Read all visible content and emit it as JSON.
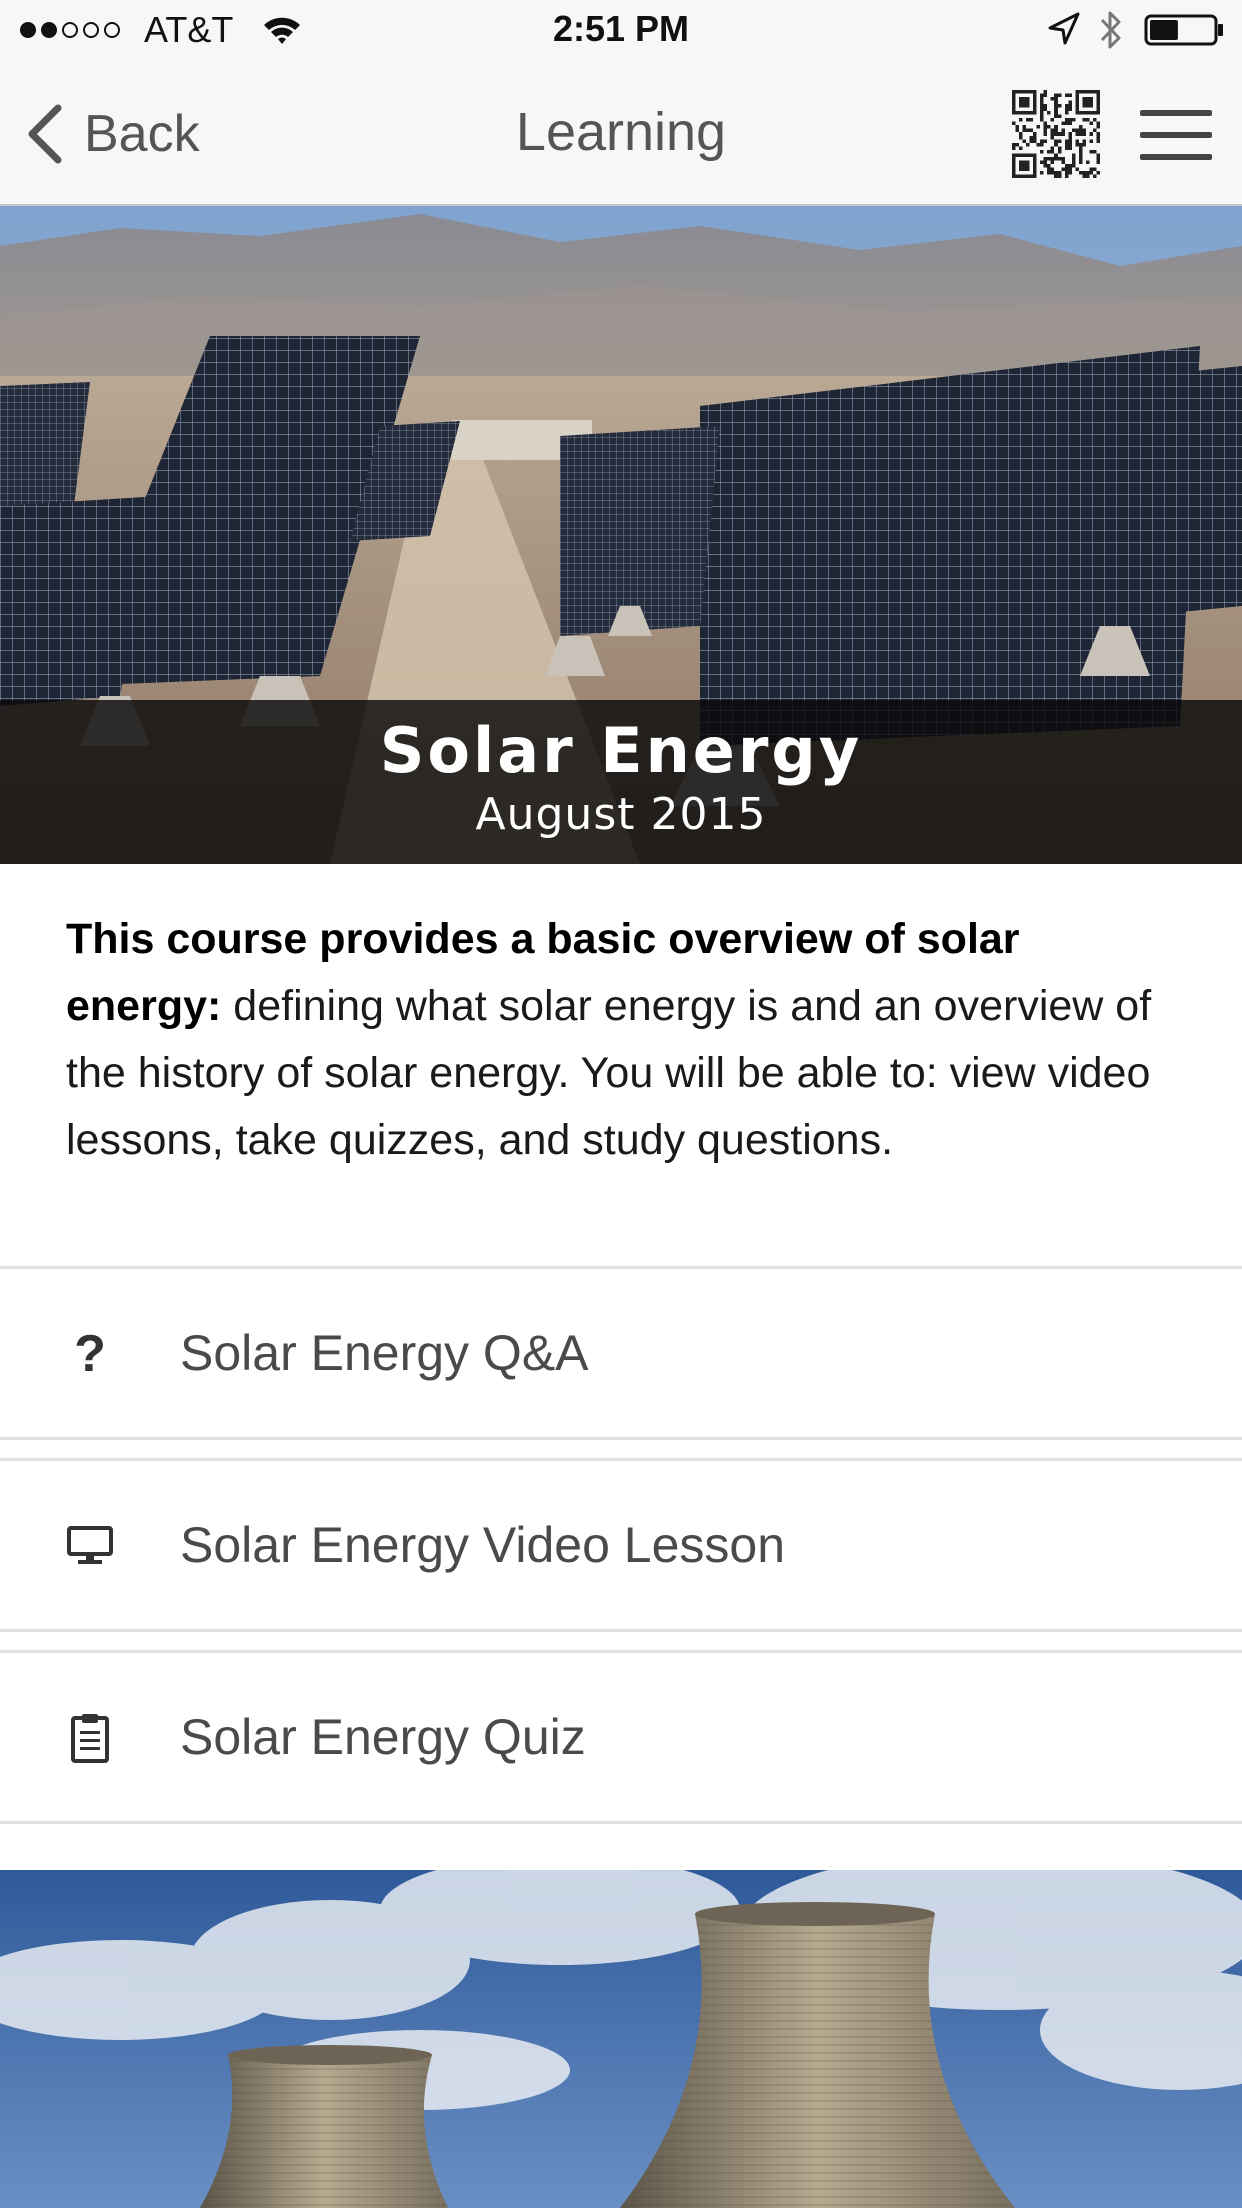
{
  "status_bar": {
    "carrier": "AT&T",
    "time": "2:51 PM",
    "signal_bars_filled": 2,
    "signal_bars_total": 5,
    "battery_level": 0.45
  },
  "nav": {
    "back_label": "Back",
    "title": "Learning",
    "qr_icon": "qr-code-icon",
    "menu_icon": "hamburger-menu-icon"
  },
  "hero": {
    "title": "Solar Energy",
    "subtitle": "August 2015"
  },
  "description": {
    "bold": "This course provides a basic overview of solar energy:",
    "text": " defining what solar energy is and an overview of the history of solar energy. You will be able to: view video lessons, take quizzes, and study questions."
  },
  "items": [
    {
      "icon": "question-mark-icon",
      "label": "Solar Energy Q&A"
    },
    {
      "icon": "monitor-icon",
      "label": "Solar Energy Video Lesson"
    },
    {
      "icon": "clipboard-icon",
      "label": "Solar Energy Quiz"
    }
  ],
  "colors": {
    "bar_background": "#f7f7f7",
    "caption_overlay": "#0a0a0a",
    "text_primary": "#1a1a1a",
    "text_secondary": "#4a4a4a",
    "divider": "#e0e0e0"
  }
}
